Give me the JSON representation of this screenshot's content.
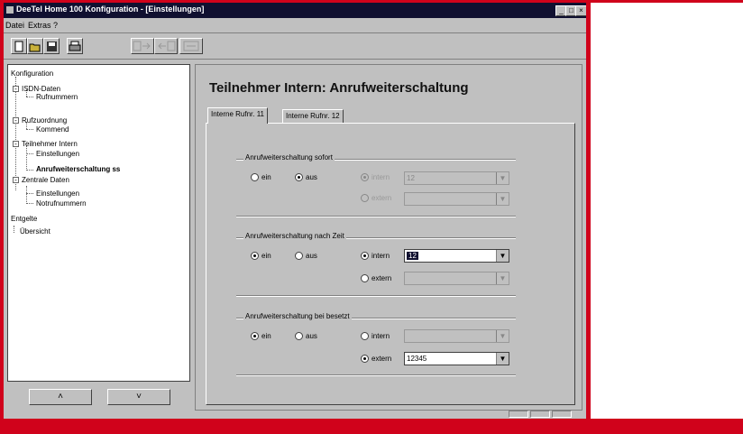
{
  "window": {
    "title": "DeeTel Home 100 Konfiguration - [Einstellungen]",
    "caption_buttons": {
      "minimize": "_",
      "maximize": "□",
      "close": "×"
    }
  },
  "menu": {
    "items": [
      "Datei",
      "Extras",
      "?"
    ]
  },
  "toolbar": {
    "icons": [
      "new-icon",
      "open-icon",
      "save-icon",
      "print-icon",
      "transfer-to-device-icon",
      "transfer-from-device-icon",
      "export-icon"
    ],
    "glyphs": {
      "new": "🗋",
      "open": "📂",
      "save": "💾",
      "print": "🖶"
    }
  },
  "tree": {
    "items": [
      {
        "label": "Konfiguration"
      },
      {
        "label": "ISDN-Daten"
      },
      {
        "label": "Rufnummern"
      },
      {
        "label": "Rufzuordnung"
      },
      {
        "label": "Kommend"
      },
      {
        "label": "Teilnehmer Intern"
      },
      {
        "label": "Einstellungen"
      },
      {
        "label": "Anrufweiterschaltung ss"
      },
      {
        "label": "Zentrale Daten"
      },
      {
        "label": "Einstellungen"
      },
      {
        "label": "Notrufnummern"
      },
      {
        "label": "Entgelte"
      },
      {
        "label": "Übersicht"
      }
    ],
    "selected": "Anrufweiterschaltung ss"
  },
  "nav_buttons": {
    "up": "˄",
    "down": "˅"
  },
  "page": {
    "title": "Teilnehmer Intern: Anrufweiterschaltung",
    "tabs": [
      {
        "label": "Interne Rufnr. 11",
        "active": true
      },
      {
        "label": "Interne Rufnr. 12",
        "active": false
      }
    ]
  },
  "groups": [
    {
      "label": "Anrufweiterschaltung sofort",
      "ein_label": "ein",
      "aus_label": "aus",
      "selected": "aus",
      "intern_label": "intern",
      "extern_label": "extern",
      "target_selected": "intern",
      "intern_value": "12",
      "extern_value": "",
      "targets_enabled": false
    },
    {
      "label": "Anrufweiterschaltung nach Zeit",
      "ein_label": "ein",
      "aus_label": "aus",
      "selected": "ein",
      "intern_label": "intern",
      "extern_label": "extern",
      "target_selected": "intern",
      "intern_value": "12",
      "extern_value": "",
      "targets_enabled": true
    },
    {
      "label": "Anrufweiterschaltung bei besetzt",
      "ein_label": "ein",
      "aus_label": "aus",
      "selected": "ein",
      "intern_label": "intern",
      "extern_label": "extern",
      "target_selected": "extern",
      "intern_value": "",
      "extern_value": "12345",
      "targets_enabled": true
    }
  ],
  "colors": {
    "frame_red": "#d0021b",
    "titlebar": "#101030",
    "face": "#c0c0c0"
  }
}
